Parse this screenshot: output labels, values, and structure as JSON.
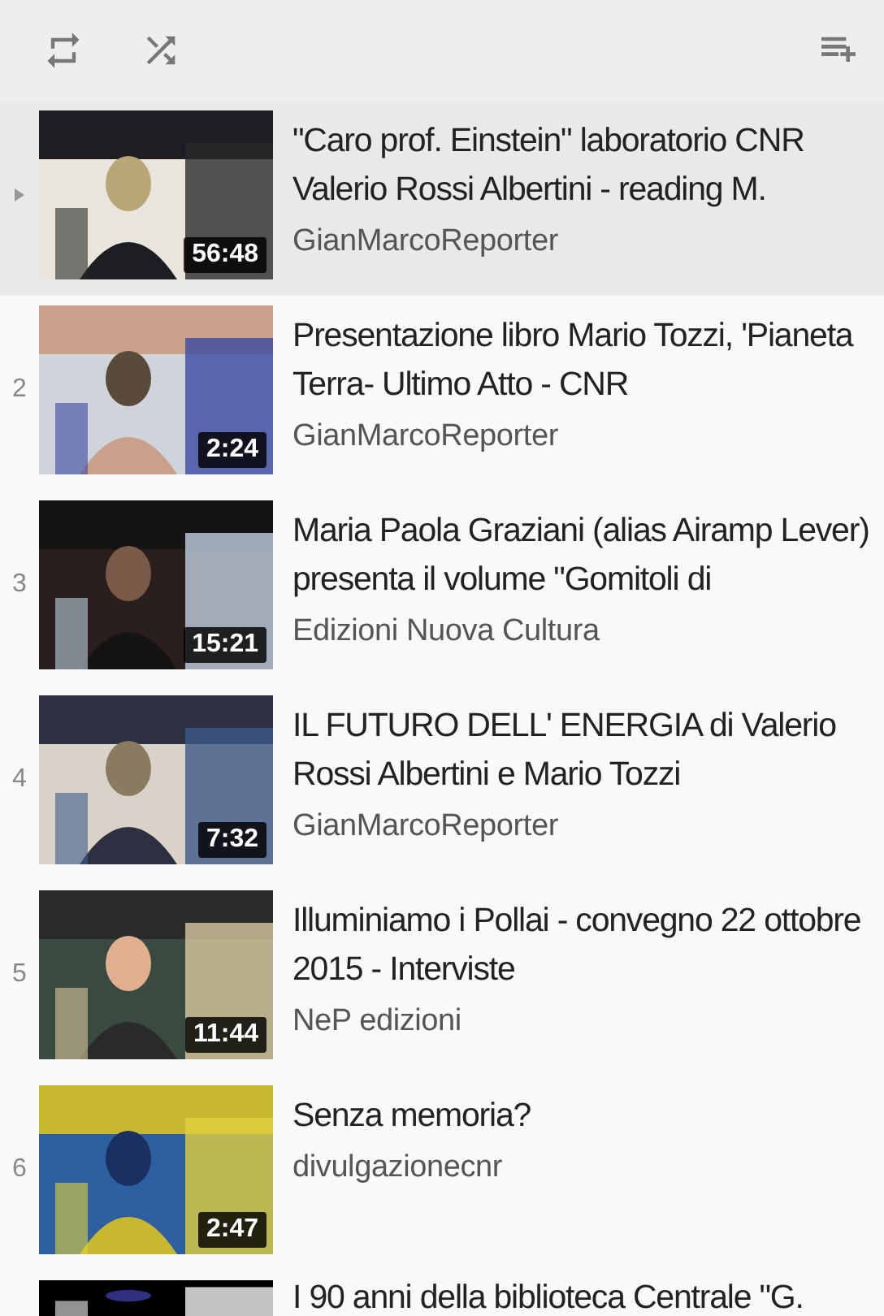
{
  "toolbar": {
    "buttons": [
      {
        "kind": "repeat"
      },
      {
        "kind": "shuffle"
      },
      {
        "kind": "add-to-queue"
      }
    ]
  },
  "videos": [
    {
      "selected": true,
      "title": "\"Caro prof. Einstein\" laboratorio CNR Valerio Rossi Albertini - reading M.",
      "channel": "GianMarcoReporter",
      "duration": "56:48"
    },
    {
      "selected": false,
      "index": "2",
      "title": "Presentazione libro Mario Tozzi, 'Pianeta Terra- Ultimo Atto - CNR",
      "channel": "GianMarcoReporter",
      "duration": "2:24"
    },
    {
      "selected": false,
      "index": "3",
      "title": "Maria Paola Graziani (alias Airamp Lever) presenta il volume \"Gomitoli di",
      "channel": "Edizioni Nuova Cultura",
      "duration": "15:21"
    },
    {
      "selected": false,
      "index": "4",
      "title": "IL FUTURO DELL' ENERGIA di Valerio Rossi Albertini e Mario Tozzi",
      "channel": "GianMarcoReporter",
      "duration": "7:32"
    },
    {
      "selected": false,
      "index": "5",
      "title": "Illuminiamo i Pollai - convegno 22 ottobre 2015 - Interviste",
      "channel": "NeP edizioni",
      "duration": "11:44"
    },
    {
      "selected": false,
      "index": "6",
      "title": "Senza memoria?",
      "channel": "divulgazionecnr",
      "duration": "2:47"
    },
    {
      "selected": false,
      "title": "I 90 anni della biblioteca Centrale \"G."
    }
  ]
}
